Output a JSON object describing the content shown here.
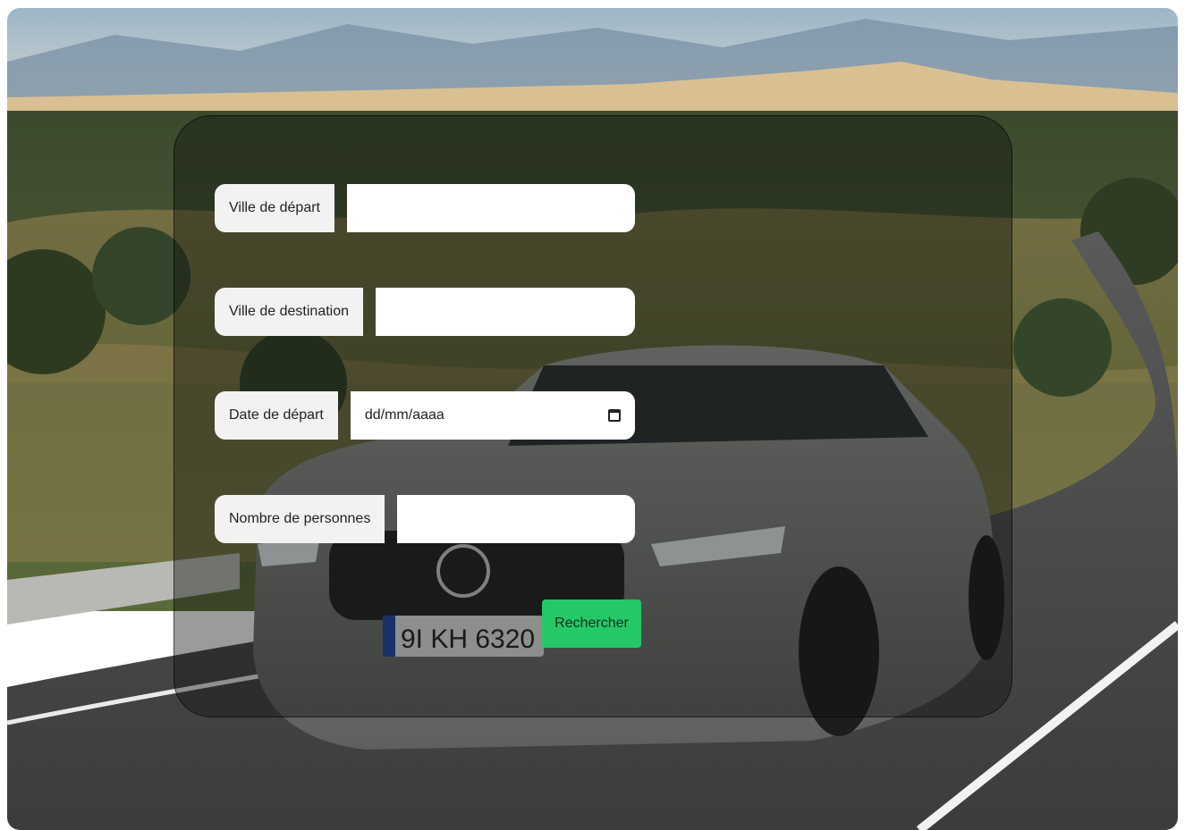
{
  "form": {
    "fields": [
      {
        "label": "Ville de départ",
        "value": ""
      },
      {
        "label": "Ville de destination",
        "value": ""
      },
      {
        "label": "Date de départ",
        "placeholder": "dd/mm/aaaa"
      },
      {
        "label": "Nombre de personnes",
        "value": ""
      }
    ],
    "submit_label": "Rechercher"
  },
  "plate": {
    "text": "9I KH 6320"
  },
  "colors": {
    "accent": "#25c866",
    "panel": "rgba(15,18,14,0.42)",
    "label_bg": "#f2f2f2"
  },
  "icons": {
    "date_picker": "calendar-icon"
  }
}
